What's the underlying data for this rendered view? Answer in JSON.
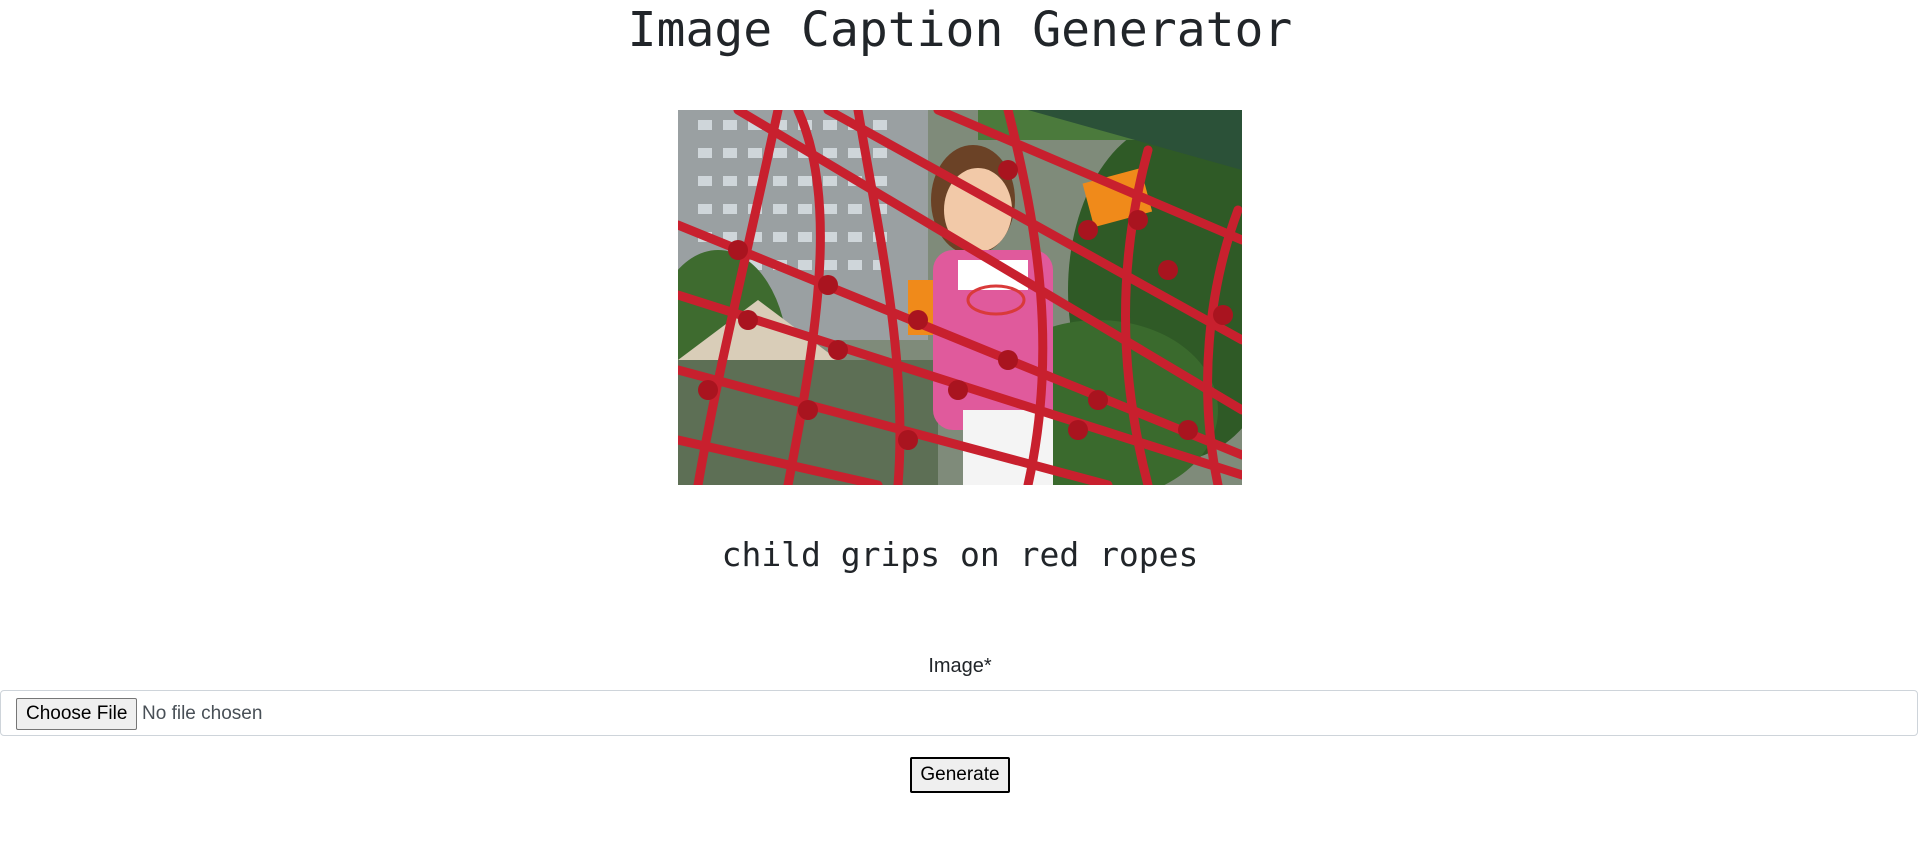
{
  "page": {
    "title": "Image Caption Generator"
  },
  "result": {
    "caption": "child grips on red ropes"
  },
  "form": {
    "image_label": "Image*",
    "choose_file_label": "Choose File",
    "file_status": "No file chosen",
    "generate_label": "Generate"
  },
  "colors": {
    "text": "#212529",
    "rope_red": "#c8202e",
    "input_border": "#ced4da",
    "button_bg": "#efefef"
  }
}
